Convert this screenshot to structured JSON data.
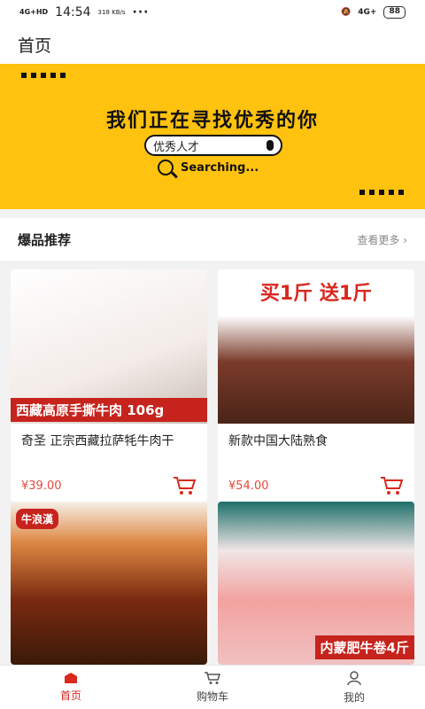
{
  "status": {
    "network": "4G+HD",
    "time": "14:54",
    "speed": "318 KB/s",
    "more": "···",
    "network_right": "4G+",
    "battery": "88"
  },
  "header": {
    "title": "首页"
  },
  "banner": {
    "title": "我们正在寻找优秀的你",
    "search_text": "优秀人才",
    "searching": "Searching..."
  },
  "section": {
    "title": "爆品推荐",
    "more": "查看更多"
  },
  "products": [
    {
      "name": "奇圣 正宗西藏拉萨牦牛肉干",
      "price": "¥39.00",
      "band": "西藏高原手撕牛肉 106g"
    },
    {
      "name": "新款中国大陆熟食",
      "price": "¥54.00",
      "band": "买1斤 送1斤"
    },
    {
      "name": "",
      "price": "",
      "band": "牛浪漢"
    },
    {
      "name": "",
      "price": "",
      "band": "内蒙肥牛卷4斤"
    }
  ],
  "nav": [
    {
      "label": "首页"
    },
    {
      "label": "购物车"
    },
    {
      "label": "我的"
    }
  ],
  "colors": {
    "banner": "#ffc20e",
    "accent": "#d9281f",
    "price": "#e64a3b"
  },
  "icons": [
    "home-icon",
    "cart-icon",
    "user-icon",
    "magnifier-icon",
    "mic-icon",
    "chevron-right-icon"
  ]
}
